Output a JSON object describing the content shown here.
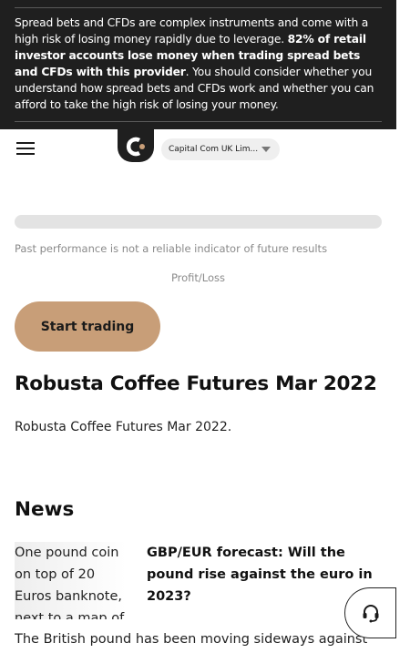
{
  "risk_warning": {
    "part1": "Spread bets and CFDs are complex instruments and come with a high risk of losing money rapidly due to leverage. ",
    "bold": "82% of retail investor accounts lose money when trading spread bets and CFDs with this provider",
    "part2": ". You should consider whether you understand how spread bets and CFDs work and whether you can afford to take the high risk of losing your money."
  },
  "header": {
    "menu_icon": "hamburger-menu-icon",
    "logo_letter": "c",
    "entity_selector": "Capital Com UK Lim..."
  },
  "chart": {
    "disclaimer": "Past performance is not a reliable indicator of future results",
    "profit_label": "Profit/Loss"
  },
  "cta": {
    "label": "Start trading"
  },
  "instrument": {
    "title": "Robusta Coffee Futures Mar 2022",
    "description": "Robusta Coffee Futures Mar 2022."
  },
  "news": {
    "heading": "News",
    "items": [
      {
        "image_alt": "One pound coin on top of 20 Euros banknote, next to a map of",
        "headline": "GBP/EUR forecast: Will the pound rise against the euro in 2023?",
        "excerpt": "The British pound has been moving sideways against"
      }
    ]
  },
  "support": {
    "icon": "headset-icon"
  },
  "colors": {
    "banner_bg": "#1f1f1f",
    "accent": "#c89e78",
    "logo_dot": "#c89e78"
  }
}
